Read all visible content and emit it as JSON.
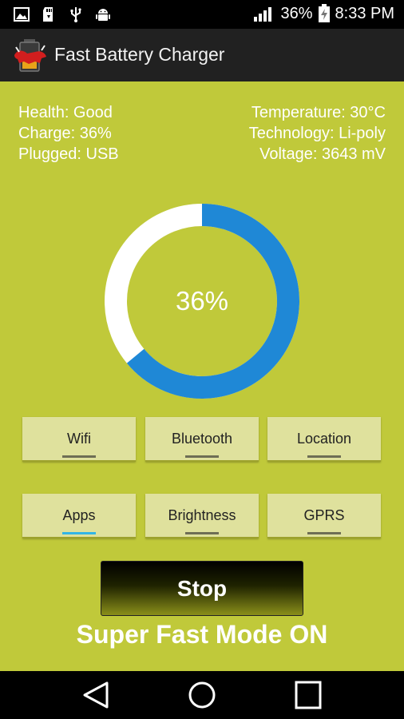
{
  "status_bar": {
    "icons_left": [
      "image-icon",
      "sd-card-icon",
      "usb-icon",
      "android-icon"
    ],
    "battery_percent": "36%",
    "time": "8:33 PM"
  },
  "app": {
    "title": "Fast Battery Charger",
    "logo_icon": "battery-bull-logo"
  },
  "battery_info": {
    "health": "Health: Good",
    "charge": "Charge: 36%",
    "plugged": "Plugged: USB",
    "temperature": "Temperature: 30°C",
    "technology": "Technology: Li-poly",
    "voltage": "Voltage: 3643 mV"
  },
  "gauge": {
    "label": "36%",
    "fraction": 0.36,
    "accent": "#1f88d6",
    "track": "#ffffff"
  },
  "toggles": [
    {
      "label": "Wifi",
      "active": false
    },
    {
      "label": "Bluetooth",
      "active": false
    },
    {
      "label": "Location",
      "active": false
    },
    {
      "label": "Apps",
      "active": true
    },
    {
      "label": "Brightness",
      "active": false
    },
    {
      "label": "GPRS",
      "active": false
    }
  ],
  "stop_button": {
    "label": "Stop"
  },
  "mode_text": "Super Fast Mode ON",
  "colors": {
    "background": "#c0c93a",
    "active_indicator": "#33b5e5"
  },
  "nav": [
    "back-icon",
    "home-icon",
    "recents-icon"
  ]
}
